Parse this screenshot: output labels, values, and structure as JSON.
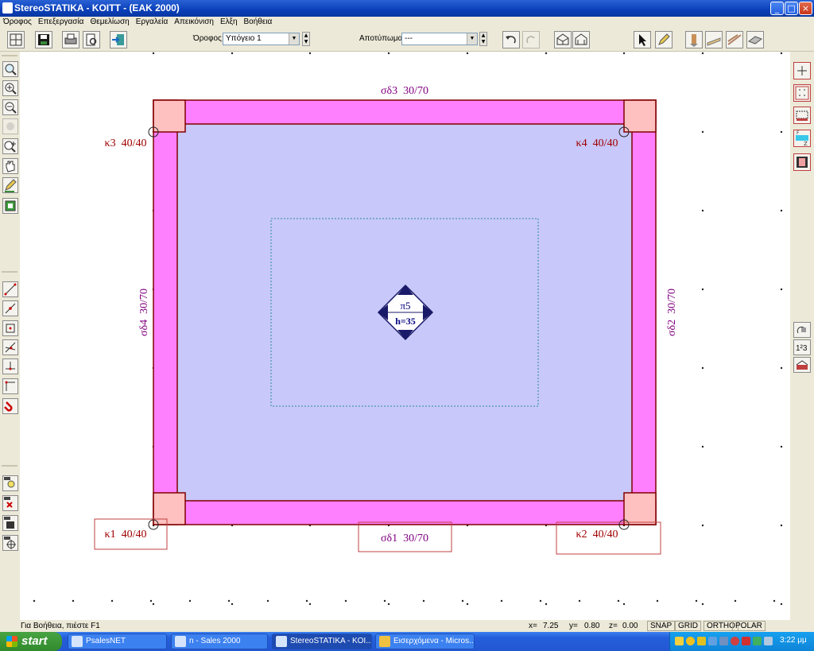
{
  "window": {
    "title": "StereoSTATIKA - KOITT - (EAK 2000)",
    "buttons": [
      "_",
      "□",
      "×"
    ]
  },
  "menu": [
    "Όροφος",
    "Επεξεργασία",
    "Θεμελίωση",
    "Εργαλεία",
    "Απεικόνιση",
    "Ελξη",
    "Βοήθεια"
  ],
  "toolbar": {
    "floor_label": "Όροφος:",
    "floor_value": "Υπόγειο 1",
    "footprint_label": "Αποτύπωμα:",
    "footprint_value": "---"
  },
  "drawing": {
    "beams": {
      "top": "σδ3  30/70",
      "right": "σδ2  30/70",
      "bottom": "σδ1  30/70",
      "left": "σδ4  30/70"
    },
    "columns": {
      "k1": "κ1  40/40",
      "k2": "κ2  40/40",
      "k3": "κ3  40/40",
      "k4": "κ4  40/40"
    },
    "slab": {
      "name": "π5",
      "thickness": "h=35"
    },
    "colors": {
      "beam_fill": "#ff80ff",
      "beam_stroke": "#800000",
      "column_fill": "#ffc0c0",
      "slab_fill": "#c8c8fa",
      "beam_label": "#800080",
      "column_label": "#a00000",
      "slab_label": "#000080"
    }
  },
  "statusbar": {
    "help": "Για Βοήθεια, πιέστε F1",
    "x_label": "x=",
    "x_value": "7.25",
    "y_label": "y=",
    "y_value": "0.80",
    "z_label": "z=",
    "z_value": "0.00",
    "modes": [
      "SNAP",
      "GRID",
      "ORTHO",
      "POLAR"
    ]
  },
  "taskbar": {
    "start": "start",
    "tasks": [
      "PsalesNET",
      "n - Sales 2000",
      "StereoSTATIKA - KOI...",
      "Εισερχόμενα - Micros..."
    ],
    "clock": "3:22 μμ"
  }
}
